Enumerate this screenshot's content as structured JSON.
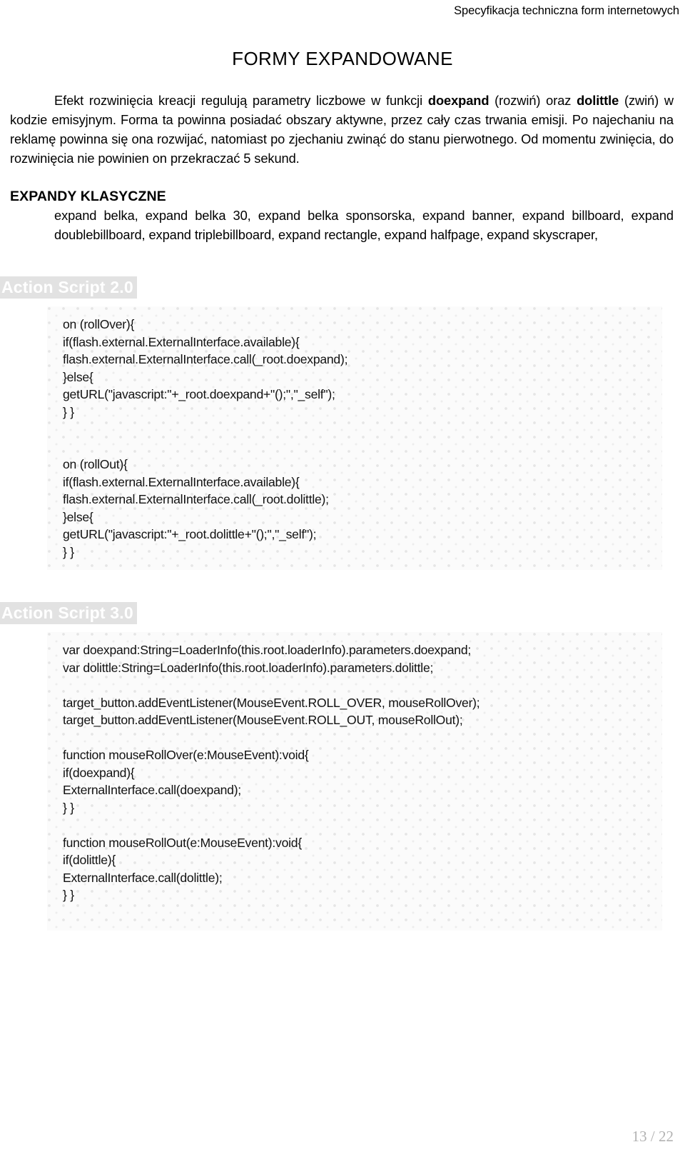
{
  "header": {
    "running_title": "Specyfikacja techniczna form internetowych"
  },
  "title": "FORMY EXPANDOWANE",
  "intro": {
    "part1": "Efekt rozwinięcia kreacji regulują parametry liczbowe w funkcji ",
    "bold1": "doexpand",
    "part2": " (rozwiń) oraz ",
    "bold2": "dolittle",
    "part3": " (zwiń) w kodzie emisyjnym. Forma ta powinna posiadać obszary aktywne, przez cały czas trwania emisji. Po najechaniu na reklamę powinna się ona rozwijać, natomiast po zjechaniu zwinąć do stanu pierwotnego. Od momentu zwinięcia, do rozwinięcia nie powinien on przekraczać 5 sekund."
  },
  "sections": [
    {
      "heading": "EXPANDY KLASYCZNE",
      "body": "expand belka, expand belka 30, expand belka sponsorska, expand banner,  expand billboard, expand doublebillboard, expand triplebillboard, expand rectangle, expand halfpage, expand skyscraper,"
    }
  ],
  "code_blocks": [
    {
      "label": "Action Script 2.0",
      "lines": [
        "on (rollOver){",
        "if(flash.external.ExternalInterface.available){",
        "flash.external.ExternalInterface.call(_root.doexpand);",
        "}else{",
        "getURL(\"javascript:\"+_root.doexpand+\"();\",\"_self\");",
        "} }",
        "",
        "",
        "on (rollOut){",
        "if(flash.external.ExternalInterface.available){",
        "flash.external.ExternalInterface.call(_root.dolittle);",
        "}else{",
        "getURL(\"javascript:\"+_root.dolittle+\"();\",\"_self\");",
        "} }"
      ]
    },
    {
      "label": "Action Script 3.0",
      "lines": [
        "var doexpand:String=LoaderInfo(this.root.loaderInfo).parameters.doexpand;",
        "var dolittle:String=LoaderInfo(this.root.loaderInfo).parameters.dolittle;",
        "",
        "target_button.addEventListener(MouseEvent.ROLL_OVER, mouseRollOver);",
        "target_button.addEventListener(MouseEvent.ROLL_OUT, mouseRollOut);",
        "",
        "function mouseRollOver(e:MouseEvent):void{",
        "if(doexpand){",
        "ExternalInterface.call(doexpand);",
        "} }",
        "",
        "function mouseRollOut(e:MouseEvent):void{",
        "if(dolittle){",
        "ExternalInterface.call(dolittle);",
        "} }",
        ""
      ]
    }
  ],
  "footer": {
    "page_number": "13 / 22"
  },
  "colors": {
    "text": "#000000",
    "as_label_bg": "#e2e2e2",
    "as_label_fg": "#ffffff",
    "code_bg": "#fbfbfb",
    "footer_text": "#b2b2b2"
  }
}
